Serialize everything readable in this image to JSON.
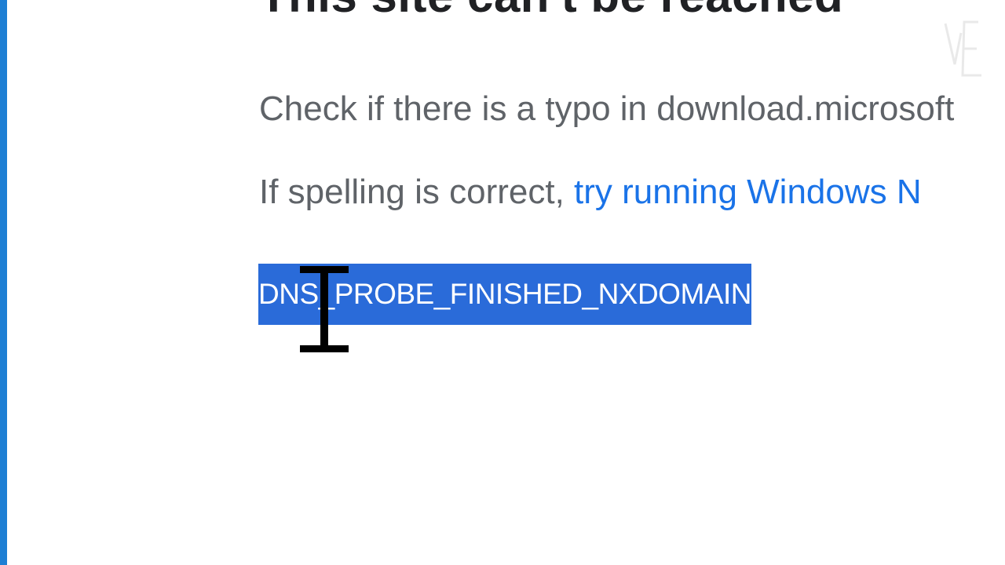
{
  "error_page": {
    "title": "This site can't be reached",
    "check_text": "Check if there is a typo in download.microsoft",
    "spelling_prefix": "If spelling is correct, ",
    "spelling_link": "try running Windows N",
    "error_code": "DNS_PROBE_FINISHED_NXDOMAIN"
  },
  "colors": {
    "window_edge": "#1e7fd4",
    "selection": "#2a6bd9",
    "link": "#1a73e8"
  },
  "icons": {
    "cursor": "text-ibeam-cursor-icon",
    "watermark": "channel-logo-watermark"
  }
}
